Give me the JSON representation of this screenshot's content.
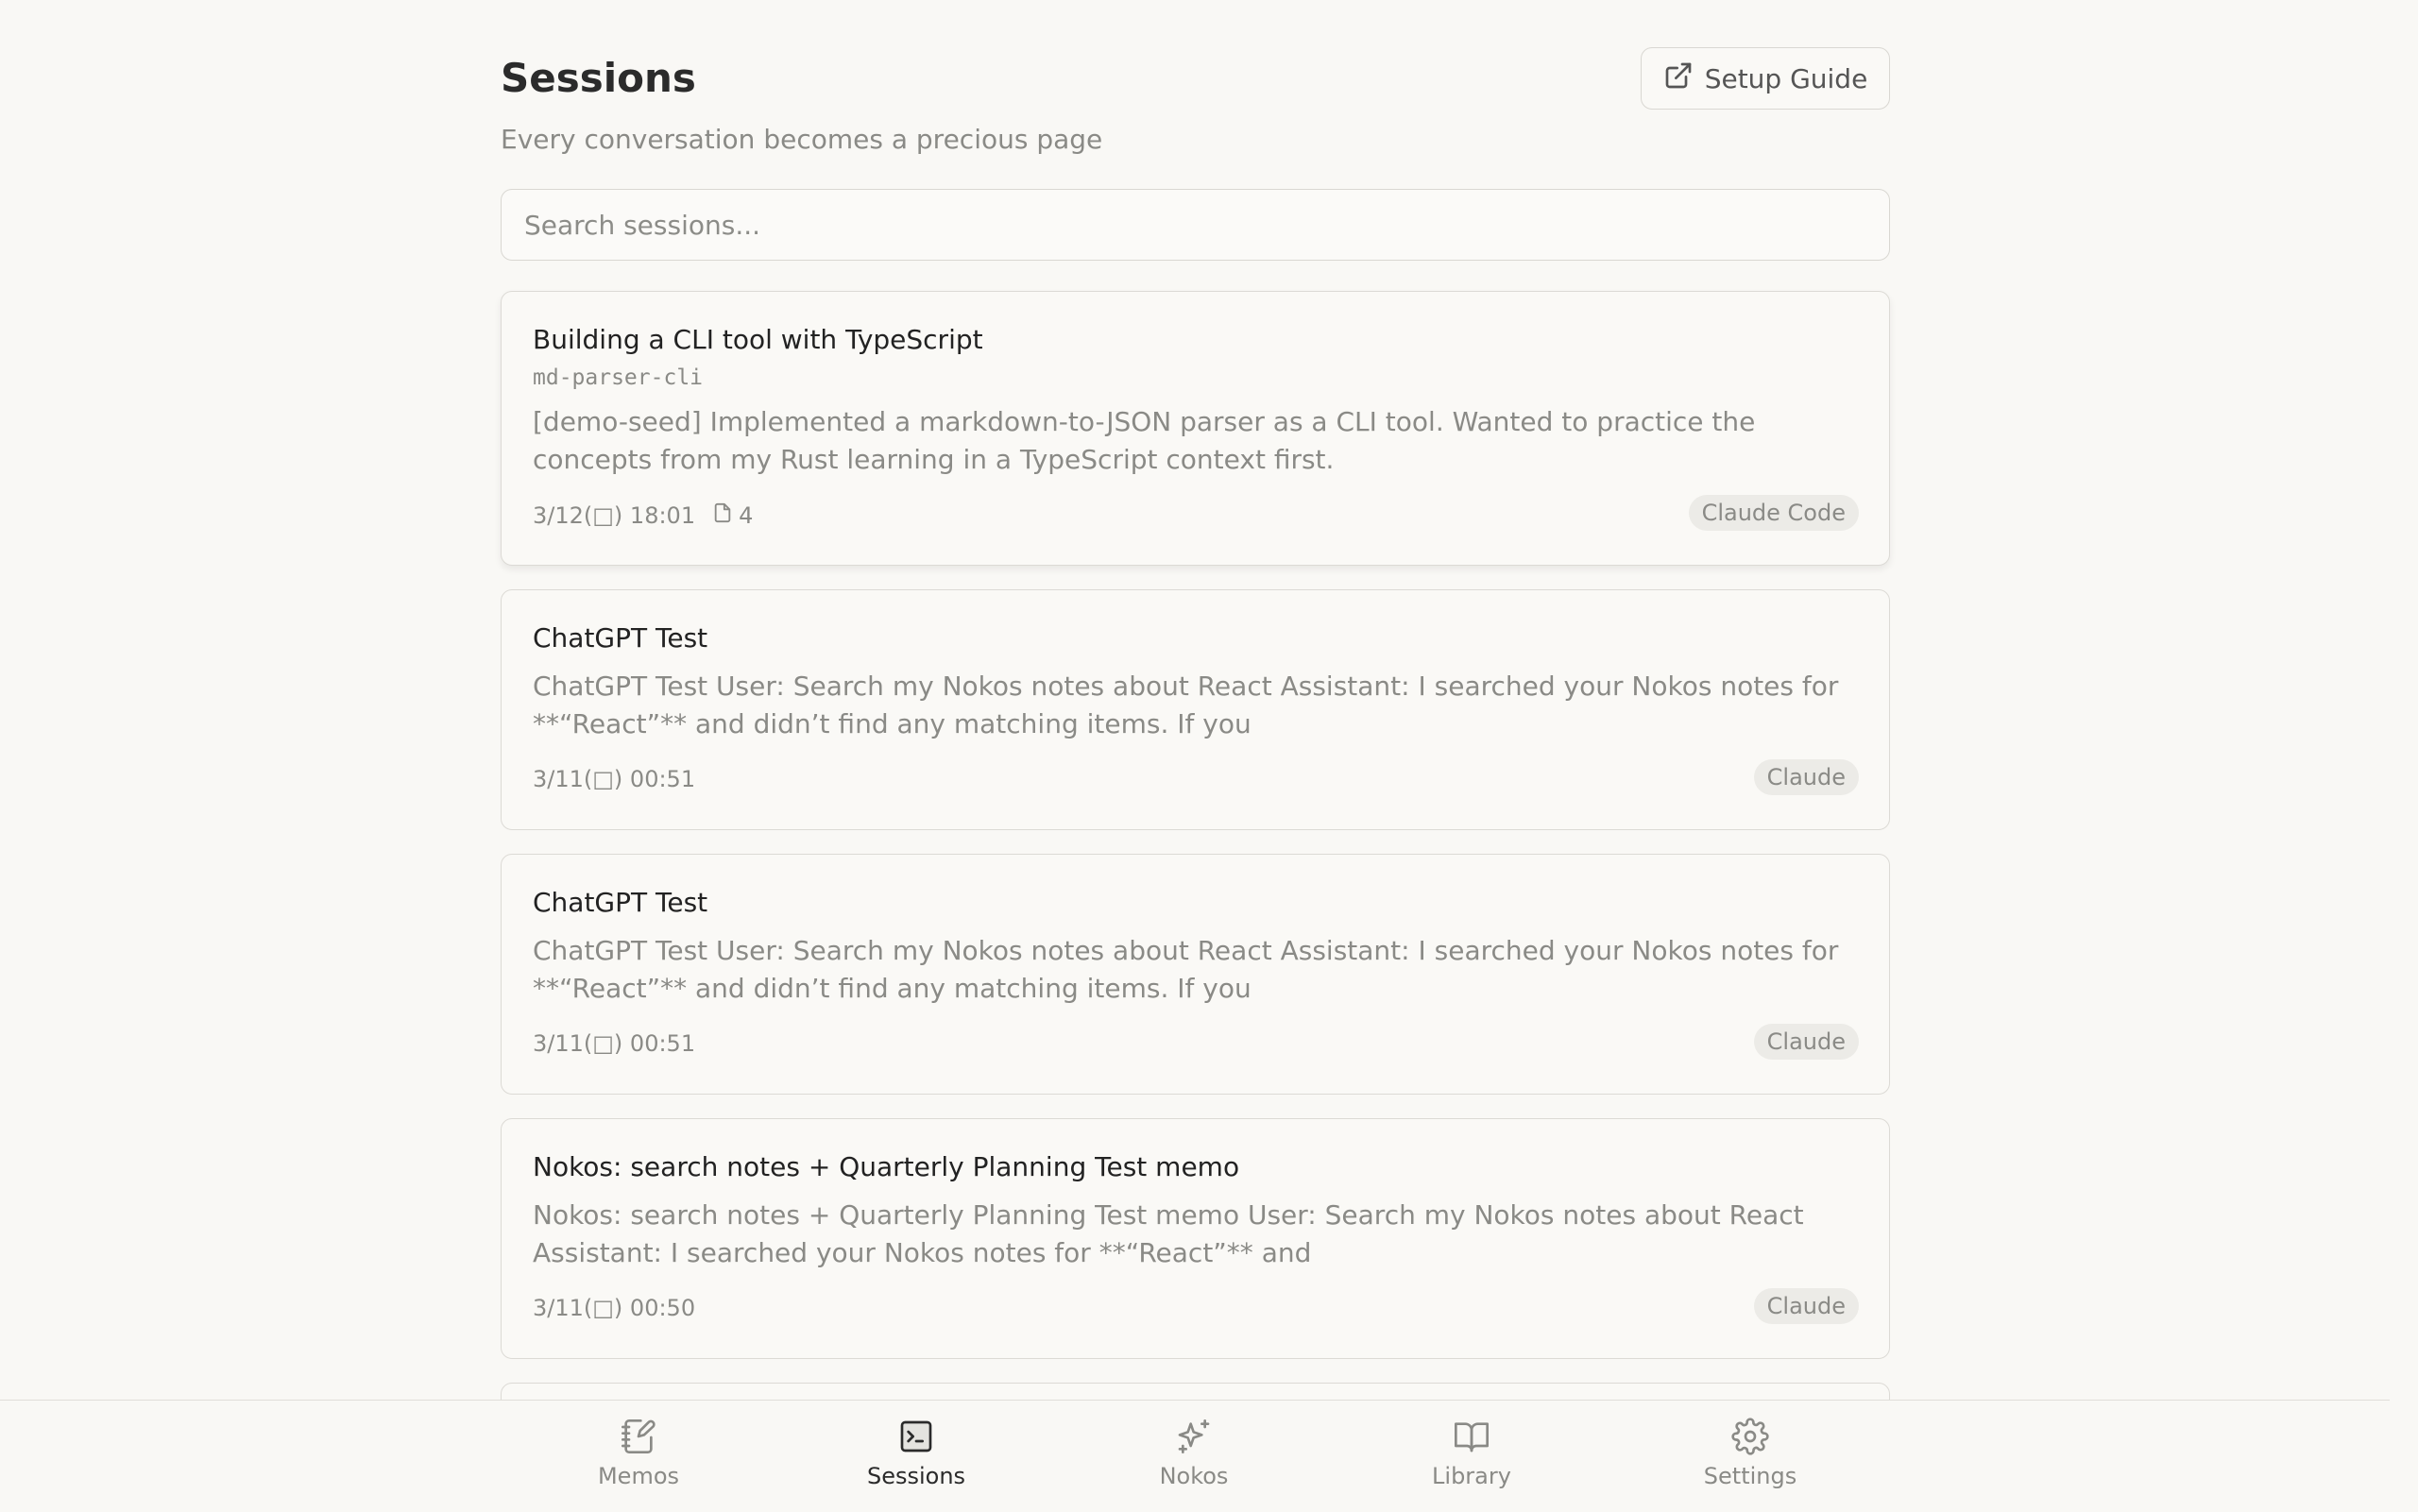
{
  "header": {
    "title": "Sessions",
    "subtitle": "Every conversation becomes a precious page",
    "setup_guide_label": "Setup Guide"
  },
  "search": {
    "placeholder": "Search sessions...",
    "value": ""
  },
  "sessions": [
    {
      "title": "Building a CLI tool with TypeScript",
      "tag": "md-parser-cli",
      "snippet": "[demo-seed] Implemented a markdown-to-JSON parser as a CLI tool. Wanted to practice the concepts from my Rust learning in a TypeScript context first.",
      "date": "3/12(□) 18:01",
      "file_count": "4",
      "source": "Claude Code"
    },
    {
      "title": "ChatGPT Test",
      "snippet": "ChatGPT Test User: Search my Nokos notes about React Assistant: I searched your Nokos notes for **“React”** and didn’t find any matching items. If you",
      "date": "3/11(□) 00:51",
      "source": "Claude"
    },
    {
      "title": "ChatGPT Test",
      "snippet": "ChatGPT Test User: Search my Nokos notes about React Assistant: I searched your Nokos notes for **“React”** and didn’t find any matching items. If you",
      "date": "3/11(□) 00:51",
      "source": "Claude"
    },
    {
      "title": "Nokos: search notes + Quarterly Planning Test memo",
      "snippet": "Nokos: search notes + Quarterly Planning Test memo User: Search my Nokos notes about React Assistant: I searched your Nokos notes for **“React”** and",
      "date": "3/11(□) 00:50",
      "source": "Claude"
    }
  ],
  "nav": [
    {
      "label": "Memos",
      "icon": "notebook-pen-icon",
      "active": false
    },
    {
      "label": "Sessions",
      "icon": "terminal-icon",
      "active": true
    },
    {
      "label": "Nokos",
      "icon": "sparkles-icon",
      "active": false
    },
    {
      "label": "Library",
      "icon": "book-open-icon",
      "active": false
    },
    {
      "label": "Settings",
      "icon": "gear-icon",
      "active": false
    }
  ],
  "colors": {
    "background": "#f9f8f5",
    "text": "#2b2b2b",
    "muted": "#8a8a86",
    "border": "#dcdad5"
  }
}
